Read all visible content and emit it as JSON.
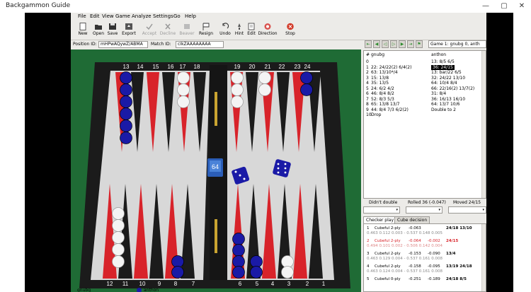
{
  "window": {
    "title": "Backgammon Guide",
    "minimize": "—",
    "maximize": "▢",
    "close": "✕"
  },
  "menu": [
    "File",
    "Edit",
    "View",
    "Game",
    "Analyze",
    "Settings",
    "Go",
    "Help"
  ],
  "toolbar": [
    {
      "label": "New",
      "icon": "new-icon",
      "enabled": true
    },
    {
      "label": "Open",
      "icon": "open-icon",
      "enabled": true
    },
    {
      "label": "Save",
      "icon": "save-icon",
      "enabled": true
    },
    {
      "label": "Export",
      "icon": "export-icon",
      "enabled": true
    },
    {
      "label": "Accept",
      "icon": "accept-icon",
      "enabled": false
    },
    {
      "label": "Decline",
      "icon": "decline-icon",
      "enabled": false
    },
    {
      "label": "Beaver",
      "icon": "beaver-icon",
      "enabled": false
    },
    {
      "label": "Resign",
      "icon": "resign-icon",
      "enabled": true
    },
    {
      "label": "Undo",
      "icon": "undo-icon",
      "enabled": true
    },
    {
      "label": "Hint",
      "icon": "hint-icon",
      "enabled": true
    },
    {
      "label": "Edit",
      "icon": "edit-icon",
      "enabled": true
    },
    {
      "label": "Direction",
      "icon": "direction-icon",
      "enabled": true
    },
    {
      "label": "Stop",
      "icon": "stop-icon",
      "enabled": true
    }
  ],
  "ids": {
    "position_label": "Position ID:",
    "position_value": "mHPwAQywZ/ABMA",
    "match_label": "Match ID:",
    "match_value": "cIkZAAAAAAAA"
  },
  "game_select": "Game 1: gnubg 0, anth",
  "board": {
    "top_numbers": [
      "13",
      "14",
      "15",
      "16",
      "17",
      "18",
      "19",
      "20",
      "21",
      "22",
      "23",
      "24"
    ],
    "bottom_numbers": [
      "12",
      "11",
      "10",
      "9",
      "8",
      "7",
      "6",
      "5",
      "4",
      "3",
      "2",
      "1"
    ],
    "cube_value": "64",
    "dice": [
      3,
      6
    ],
    "colors": {
      "felt": "#1f6b35",
      "frame": "#1b1b1b",
      "red_point": "#d8232a",
      "black_point": "#1b1b1b",
      "blue_checker": "#1a1aa6",
      "white_checker": "#f4f4f4",
      "bar": "#151515"
    },
    "players": [
      "gnubg",
      "anthon"
    ]
  },
  "movelist": {
    "headers": [
      "#",
      "gnubg",
      "anthon"
    ],
    "rows": [
      {
        "n": "0",
        "a": "",
        "b": "13: 8/5 6/5",
        "sel": false
      },
      {
        "n": "1",
        "a": "22: 24/22(2) 6/4(2)",
        "b": "36: 24/15",
        "sel": true
      },
      {
        "n": "2",
        "a": "63: 13/10*/4",
        "b": "13: bar/22 6/5",
        "sel": false
      },
      {
        "n": "3",
        "a": "15: 13/8",
        "b": "32: 24/22 13/10",
        "sel": false
      },
      {
        "n": "4",
        "a": "35: 13/5",
        "b": "64: 10/4 8/4",
        "sel": false
      },
      {
        "n": "5",
        "a": "24: 6/2 4/2",
        "b": "66: 22/16(2) 13/7(2)",
        "sel": false
      },
      {
        "n": "6",
        "a": "46: 8/4 8/2",
        "b": "31: 8/4",
        "sel": false
      },
      {
        "n": "7",
        "a": "52: 8/3 5/3",
        "b": "36: 16/13 16/10",
        "sel": false
      },
      {
        "n": "8",
        "a": "65: 13/8 13/7",
        "b": "64: 13/7 10/6",
        "sel": false
      },
      {
        "n": "9",
        "a": "44: 8/4 7/3 6/2(2)",
        "b": "Double to 2",
        "sel": false
      },
      {
        "n": "10",
        "a": "Drop",
        "b": "",
        "sel": false
      }
    ]
  },
  "status": {
    "left": "Didn't double",
    "mid": "Rolled 36 (-0.047)",
    "right": "Moved 24/15"
  },
  "tabs": [
    "Checker play",
    "Cube decision"
  ],
  "analysis": [
    {
      "line1": [
        "1",
        "Cubeful 2-ply",
        "-0.063",
        "",
        "24/18 13/10"
      ],
      "line2": "0.463 0.112 0.003 - 0.537 0.148 0.005",
      "red": false
    },
    {
      "line1": [
        "2",
        "Cubeful 2-ply",
        "-0.064",
        "-0.002",
        "24/15"
      ],
      "line2": "0.494 0.101 0.002 - 0.506 0.142 0.004",
      "red": true
    },
    {
      "line1": [
        "3",
        "Cubeful 2-ply",
        "-0.153",
        "-0.090",
        "13/4"
      ],
      "line2": "0.463 0.129 0.004 - 0.537 0.161 0.008",
      "red": false
    },
    {
      "line1": [
        "4",
        "Cubeful 2-ply",
        "-0.158",
        "-0.095",
        "13/19 24/18"
      ],
      "line2": "0.463 0.124 0.004 - 0.537 0.161 0.008",
      "red": false
    },
    {
      "line1": [
        "5",
        "Cubeful 0-ply",
        "-0.251",
        "-0.189",
        "24/18 8/5"
      ],
      "line2": "",
      "red": false
    }
  ],
  "footer": {
    "p1": "gnubg",
    "p2": "anthon"
  }
}
